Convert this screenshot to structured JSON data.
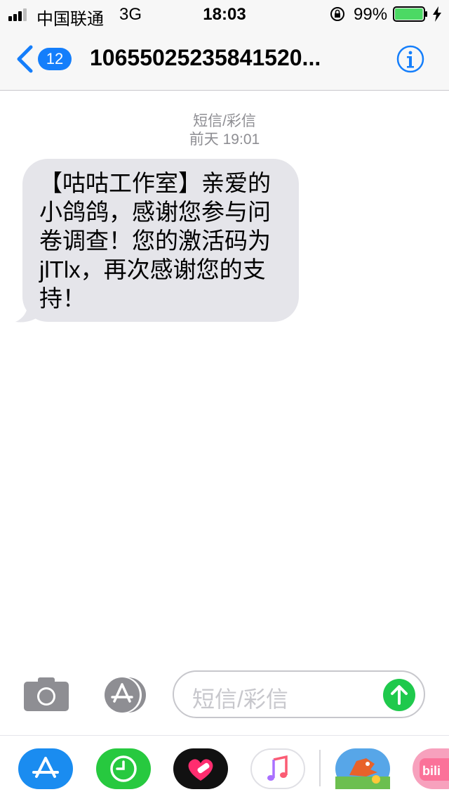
{
  "status_bar": {
    "carrier": "中国联通",
    "network": "3G",
    "time": "18:03",
    "battery_percent": "99%",
    "battery_level": 0.99
  },
  "nav": {
    "back_badge": "12",
    "title": "1065502523584152​0..."
  },
  "conversation": {
    "message_type": "短信/彩信",
    "timestamp": "前天 19:01",
    "messages": [
      {
        "direction": "incoming",
        "text": "【咕咕工作室】亲爱的小鸽鸽，感谢您参与问卷调查！您的激活码为jlTlx，再次感谢您的支持！"
      }
    ]
  },
  "composer": {
    "placeholder": "短信/彩信"
  },
  "app_drawer": {
    "apps": [
      {
        "icon": "app-store-icon"
      },
      {
        "icon": "digital-touch-icon"
      },
      {
        "icon": "heart-sticker-icon"
      },
      {
        "icon": "music-icon"
      },
      {
        "icon": "game-dragon-icon"
      },
      {
        "icon": "bilibili-icon"
      }
    ]
  },
  "colors": {
    "accent": "#147efb",
    "bubble": "#e5e5ea",
    "send": "#1fc94c",
    "battery": "#4cd964"
  }
}
